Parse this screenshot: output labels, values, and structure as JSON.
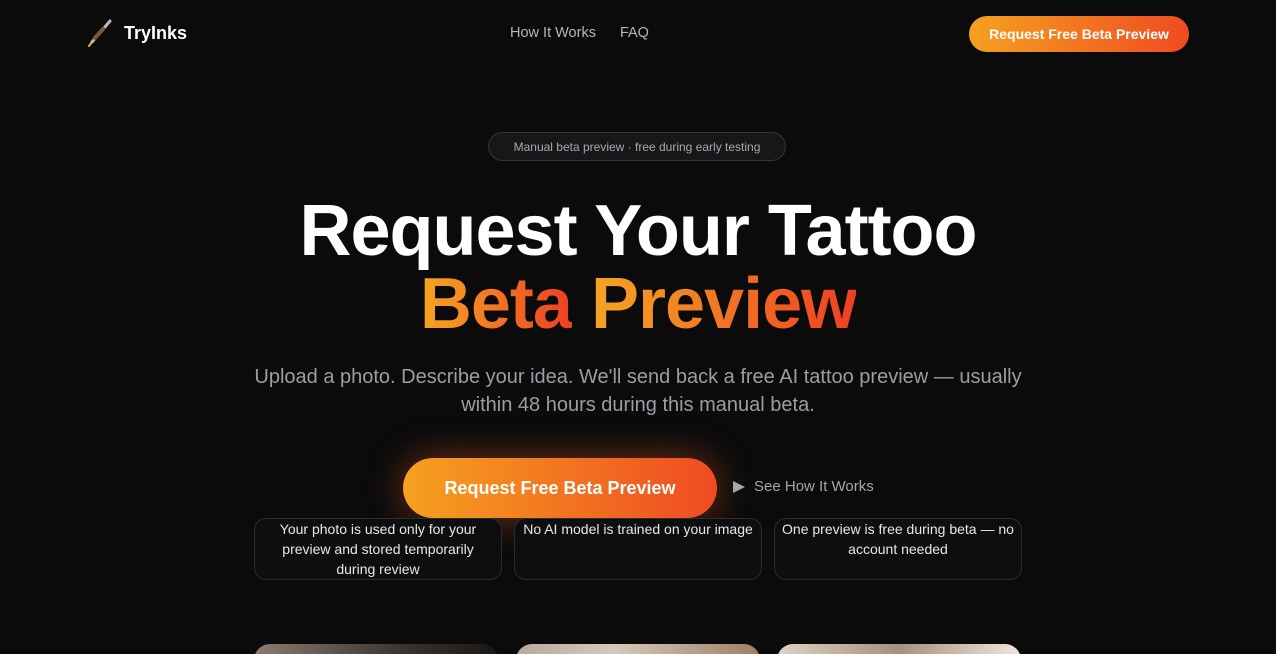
{
  "header": {
    "logo_text": "TryInks",
    "logo_icon": "tattoo-pen-icon",
    "nav": [
      {
        "label": "How It Works"
      },
      {
        "label": "FAQ"
      }
    ],
    "cta_label": "Request Free Beta Preview"
  },
  "hero": {
    "badge": "Manual beta preview · free during early testing",
    "title_line1": "Request Your Tattoo",
    "title_line2_a": "Beta",
    "title_line2_b": "Preview",
    "subtitle": "Upload a photo. Describe your idea. We'll send back a free AI tattoo preview — usually within 48 hours during this manual beta.",
    "primary_cta": "Request Free Beta Preview",
    "secondary_cta": "See How It Works",
    "secondary_icon": "play-icon"
  },
  "trust_points": [
    {
      "text": "Your photo is used only for your preview and stored temporarily during review"
    },
    {
      "text": "No AI model is trained on your image"
    },
    {
      "text": "One preview is free during beta — no account needed"
    }
  ],
  "colors": {
    "background": "#0b0b0c",
    "accent_start": "#f5a11f",
    "accent_end": "#ef4b22",
    "muted_text": "#9d9da3"
  }
}
